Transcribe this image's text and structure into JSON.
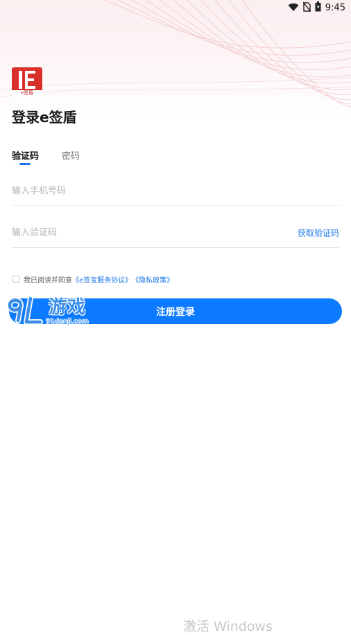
{
  "status_bar": {
    "time": "9:45",
    "icons": [
      "wifi-icon",
      "no-sim-icon",
      "battery-icon"
    ]
  },
  "brand": {
    "logo_caption": "e签盾",
    "title": "登录e签盾",
    "accent_color": "#d8302b"
  },
  "tabs": {
    "active_label": "验证码",
    "inactive_label": "密码"
  },
  "form": {
    "phone_placeholder": "输入手机号码",
    "code_placeholder": "输入验证码",
    "get_code_label": "获取验证码"
  },
  "agreement": {
    "prefix": "我已阅读并同意",
    "service_link": "《e签宝服务协议》",
    "privacy_link": "《隐私政策》"
  },
  "submit": {
    "label": "注册登录",
    "color": "#0d7bff"
  },
  "watermark": {
    "site_name": "游戏",
    "domain": "91danji.com"
  },
  "os_watermark": "激活 Windows"
}
